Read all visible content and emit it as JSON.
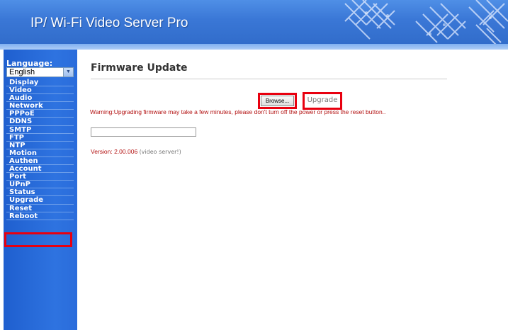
{
  "header": {
    "title": "IP/ Wi-Fi Video Server Pro"
  },
  "sidebar": {
    "language_label": "Language:",
    "language_value": "English",
    "items": [
      {
        "label": "Display"
      },
      {
        "label": "Video"
      },
      {
        "label": "Audio"
      },
      {
        "label": "Network"
      },
      {
        "label": "PPPoE"
      },
      {
        "label": "DDNS"
      },
      {
        "label": "SMTP"
      },
      {
        "label": "FTP"
      },
      {
        "label": "NTP"
      },
      {
        "label": "Motion"
      },
      {
        "label": "Authen"
      },
      {
        "label": "Account"
      },
      {
        "label": "Port"
      },
      {
        "label": "UPnP"
      },
      {
        "label": "Status"
      },
      {
        "label": "Upgrade"
      },
      {
        "label": "Reset"
      },
      {
        "label": "Reboot"
      }
    ]
  },
  "main": {
    "title": "Firmware Update",
    "browse_label": "Browse...",
    "upgrade_label": "Upgrade",
    "warning": "Warning:Upgrading firmware may take a few minutes, please don't turn off the power or press the reset button..",
    "file_value": "",
    "version_label": "Version:",
    "version_number": "2.00.006",
    "version_desc": "(video server!)"
  },
  "colors": {
    "highlight": "#e8000f",
    "sidebar": "#2e73e0",
    "warning": "#b31212"
  }
}
